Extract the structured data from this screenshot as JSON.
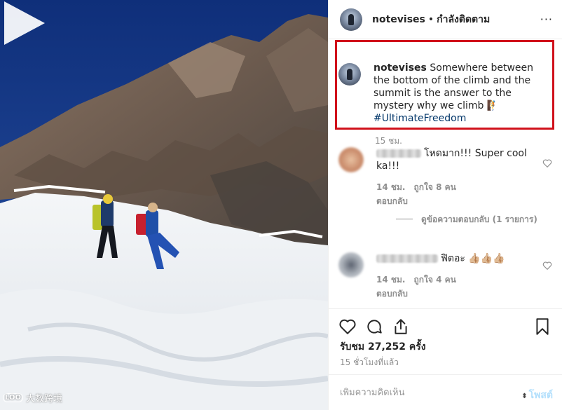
{
  "header": {
    "username": "notevises",
    "separator": "•",
    "follow_status": "กำลังติดตาม",
    "more_icon": "ellipsis-icon",
    "more_glyph": "···"
  },
  "caption": {
    "username": "notevises",
    "text": "Somewhere between the bottom of the climb and the summit is the answer to the mystery why we climb 🧗",
    "hashtag": "#UltimateFreedom",
    "time": "15 ชม.",
    "highlight_color": "#d0111b"
  },
  "comments": [
    {
      "text": "โหดมาก!!! Super cool ka!!!",
      "time": "14 ชม.",
      "likes": "ถูกใจ 8 คน",
      "reply": "ตอบกลับ",
      "view_replies": "ดูข้อความตอบกลับ (1 รายการ)"
    },
    {
      "text": "ฟิตอะ 👍🏼👍🏼👍🏼",
      "time": "14 ชม.",
      "likes": "ถูกใจ 4 คน",
      "reply": "ตอบกลับ"
    }
  ],
  "actions": {
    "like_icon": "heart-icon",
    "comment_icon": "comment-icon",
    "share_icon": "share-icon",
    "save_icon": "bookmark-icon"
  },
  "stats": {
    "views": "รับชม 27,252 ครั้ง",
    "posted": "15 ชั่วโมงที่แล้ว"
  },
  "add_comment": {
    "placeholder": "เพิ่มความคิดเห็น",
    "post_label": "โพสต์"
  },
  "media": {
    "type": "video",
    "play_icon": "play-icon",
    "watermark": "大数跨境",
    "watermark_logo": "LOO"
  }
}
